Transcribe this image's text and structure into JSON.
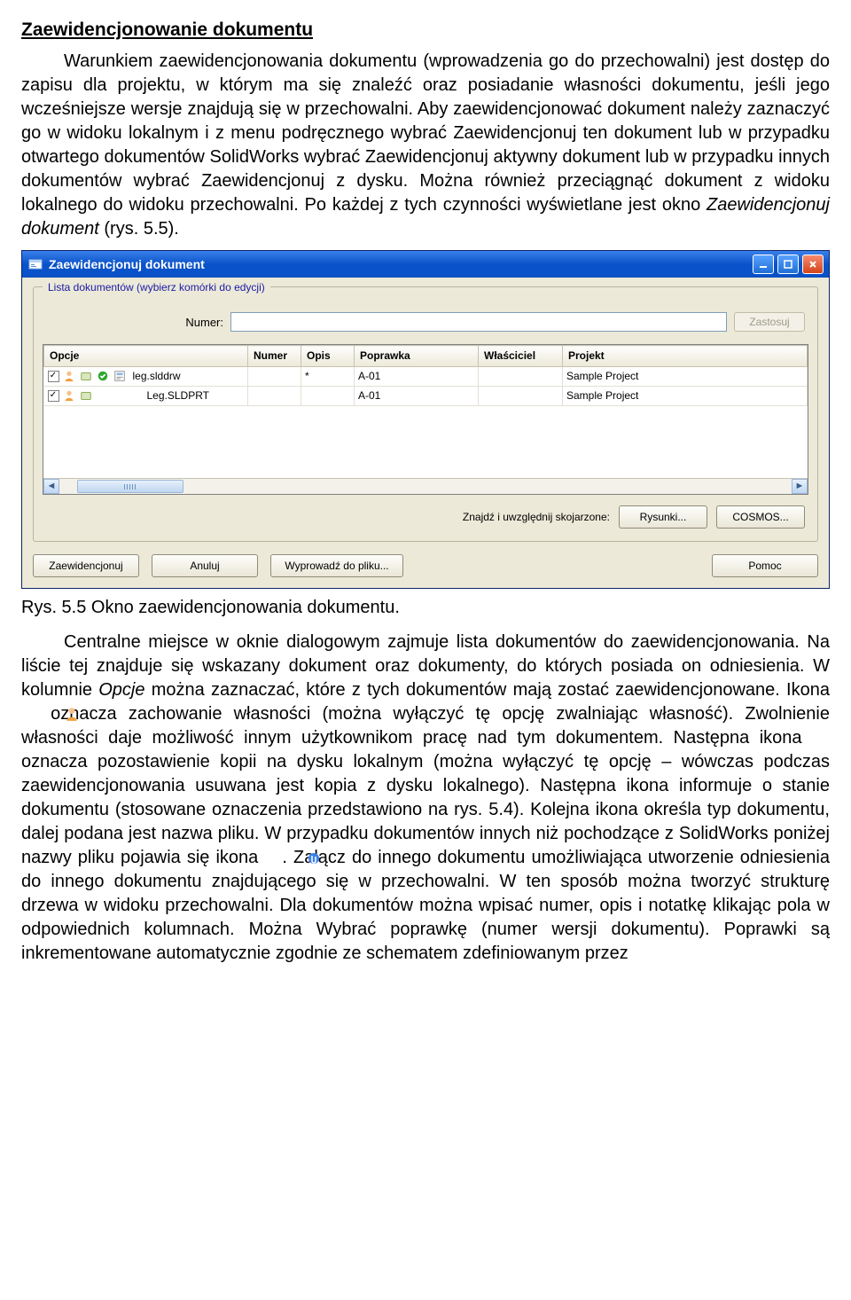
{
  "heading": "Zaewidencjonowanie dokumentu",
  "para1": "Warunkiem zaewidencjonowania dokumentu (wprowadzenia go do przechowalni) jest dostęp do zapisu dla projektu, w którym ma się znaleźć oraz posiadanie własności dokumentu, jeśli jego wcześniejsze wersje znajdują się w przechowalni. Aby zaewidencjonować dokument należy zaznaczyć go w widoku lokalnym i z menu podręcznego wybrać Zaewidencjonuj ten dokument lub w przypadku otwartego dokumentów SolidWorks wybrać Zaewidencjonuj aktywny dokument lub w przypadku innych dokumentów wybrać Zaewidencjonuj z dysku. Można również przeciągnąć dokument z widoku lokalnego do widoku przechowalni. Po każdej z tych czynności wyświetlane jest okno ",
  "para1_em": "Zaewidencjonuj dokument",
  "para1_tail": " (rys. 5.5).",
  "window": {
    "title": "Zaewidencjonuj dokument",
    "legend": "Lista dokumentów (wybierz komórki do edycji)",
    "numer_label": "Numer:",
    "numer_value": "",
    "zastosuj": "Zastosuj",
    "columns": {
      "opcje": "Opcje",
      "numer": "Numer",
      "opis": "Opis",
      "poprawka": "Poprawka",
      "wlasciciel": "Właściciel",
      "projekt": "Projekt"
    },
    "rows": [
      {
        "file": "leg.slddrw",
        "numer": "",
        "opis": "*",
        "poprawka": "A-01",
        "wlasciciel": "",
        "projekt": "Sample Project",
        "checked": true
      },
      {
        "file": "Leg.SLDPRT",
        "numer": "",
        "opis": "",
        "poprawka": "A-01",
        "wlasciciel": "",
        "projekt": "Sample Project",
        "checked": true
      }
    ],
    "find_label": "Znajdź i uwzględnij skojarzone:",
    "btn_rysunki": "Rysunki...",
    "btn_cosmos": "COSMOS...",
    "btn_zaewidencjonuj": "Zaewidencjonuj",
    "btn_anuluj": "Anuluj",
    "btn_wyprowadz": "Wyprowadź do pliku...",
    "btn_pomoc": "Pomoc"
  },
  "fig_caption": "Rys. 5.5 Okno zaewidencjonowania dokumentu.",
  "para2a": "Centralne miejsce w oknie dialogowym zajmuje lista dokumentów do zaewidencjonowania. Na liście tej znajduje się wskazany dokument oraz dokumenty, do których posiada on odniesienia. W kolumnie ",
  "para2a_em": "Opcje",
  "para2a_tail": " można zaznaczać, które z tych dokumentów mają zostać zaewidencjonowane. Ikona ",
  "para2b": " oznacza zachowanie własności (można wyłączyć tę opcję zwalniając własność). Zwolnienie własności daje możliwość innym użytkownikom pracę nad tym dokumentem. Następna ikona ",
  "para2c": " oznacza pozostawienie kopii na dysku lokalnym (można wyłączyć tę opcję – wówczas podczas zaewidencjonowania usuwana jest kopia z dysku lokalnego). Następna ikona informuje o stanie dokumentu (stosowane oznaczenia przedstawiono na rys. 5.4). Kolejna ikona określa typ dokumentu, dalej podana jest nazwa pliku. W przypadku dokumentów innych niż pochodzące z SolidWorks poniżej nazwy pliku pojawia się ikona ",
  "para2d_tail": ". Załącz do innego dokumentu umożliwiająca utworzenie odniesienia do innego dokumentu znajdującego się w przechowalni. W ten sposób można tworzyć strukturę drzewa w widoku przechowalni. Dla dokumentów można wpisać numer, opis i notatkę klikając pola w odpowiednich kolumnach. Można Wybrać poprawkę (numer wersji dokumentu). Poprawki są inkrementowane automatycznie zgodnie ze schematem zdefiniowanym przez"
}
